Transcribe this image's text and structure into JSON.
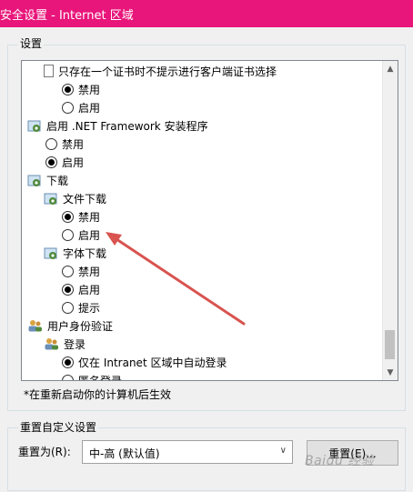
{
  "window": {
    "title": "安全设置 - Internet 区域"
  },
  "settings_group": {
    "label": "设置"
  },
  "tree": {
    "items": [
      {
        "kind": "doc",
        "label": "只存在一个证书时不提示进行客户端证书选择"
      },
      {
        "kind": "radio",
        "label": "禁用",
        "checked": true
      },
      {
        "kind": "radio",
        "label": "启用",
        "checked": false
      },
      {
        "kind": "gear",
        "label": "启用 .NET Framework 安装程序"
      },
      {
        "kind": "radio",
        "label": "禁用",
        "checked": false
      },
      {
        "kind": "radio",
        "label": "启用",
        "checked": true
      },
      {
        "kind": "gear",
        "label": "下载"
      },
      {
        "kind": "gear",
        "label": "文件下载"
      },
      {
        "kind": "radio",
        "label": "禁用",
        "checked": true
      },
      {
        "kind": "radio",
        "label": "启用",
        "checked": false
      },
      {
        "kind": "gear",
        "label": "字体下载"
      },
      {
        "kind": "radio",
        "label": "禁用",
        "checked": false
      },
      {
        "kind": "radio",
        "label": "启用",
        "checked": true
      },
      {
        "kind": "radio",
        "label": "提示",
        "checked": false
      },
      {
        "kind": "users",
        "label": "用户身份验证"
      },
      {
        "kind": "users",
        "label": "登录"
      },
      {
        "kind": "radio",
        "label": "仅在 Intranet 区域中自动登录",
        "checked": true
      },
      {
        "kind": "radio",
        "label": "匿名登录",
        "checked": false
      }
    ]
  },
  "note": "*在重新启动你的计算机后生效",
  "reset_group": {
    "label": "重置自定义设置",
    "reset_to_label": "重置为(R):",
    "selected_level": "中-高 (默认值)",
    "reset_button": "重置(E)..."
  },
  "watermark": "Baidu 经验",
  "colors": {
    "titlebar": "#e8157a",
    "annotation_arrow": "#d9534f"
  }
}
